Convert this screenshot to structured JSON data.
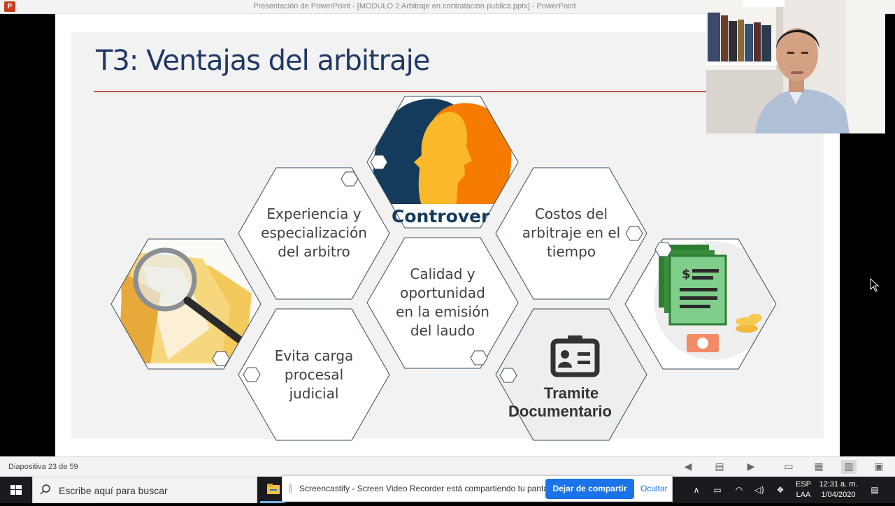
{
  "window": {
    "title": "Presentación de PowerPoint - [MODULO 2 Arbitraje en contratacion publica.pptx] - PowerPoint",
    "app_icon": "powerpoint-icon",
    "app_icon_letter": "P"
  },
  "slide": {
    "title": "T3: Ventajas del arbitraje",
    "hexagons": [
      {
        "id": "experiencia",
        "lines": [
          "Experiencia y",
          "especialización",
          "del arbitro"
        ]
      },
      {
        "id": "costos",
        "lines": [
          "Costos del",
          "arbitraje en el",
          "tiempo"
        ]
      },
      {
        "id": "calidad",
        "lines": [
          "Calidad y",
          "oportunidad",
          "en la emisión",
          "del laudo"
        ]
      },
      {
        "id": "evita",
        "lines": [
          "Evita carga",
          "procesal",
          "judicial"
        ]
      }
    ],
    "image_captions": {
      "controversy": "Controver",
      "tramite_line1": "Tramite",
      "tramite_line2": "Documentario"
    }
  },
  "status_bar": {
    "slide_counter": "Diapositiva 23 de 59"
  },
  "taskbar": {
    "search_placeholder": "Escribe aquí para buscar",
    "language_line1": "ESP",
    "language_line2": "LAA",
    "time": "12:31 a. m.",
    "date": "1/04/2020"
  },
  "share_bar": {
    "message": "Screencastify - Screen Video Recorder está compartiendo tu pantalla.",
    "stop_label": "Dejar de compartir",
    "hide_label": "Ocultar"
  },
  "colors": {
    "title": "#1f3864",
    "rule": "#c0504d",
    "hex_outline": "#3a4a5c",
    "navy_head": "#143b5c",
    "orange_head": "#f57c00",
    "yellow_head": "#fbb829",
    "share_button": "#1a73e8"
  }
}
